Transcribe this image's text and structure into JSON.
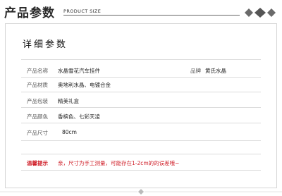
{
  "header": {
    "title": "产品参数",
    "subtitle": "PRODUCT SIZE"
  },
  "card": {
    "title": "详细参数"
  },
  "params": [
    {
      "label": "产品名称",
      "value": "水晶雪花汽车挂件",
      "extra_label": "品牌",
      "extra_value": "黄氏水晶"
    },
    {
      "label": "产品材质",
      "value": "奥地利水晶、电镀合金"
    },
    {
      "label": "产品包装",
      "value": "精美礼盒"
    },
    {
      "label": "产品颜色",
      "value": "香槟色、七彩天凌"
    },
    {
      "label": "产品尺寸",
      "value": "80cm"
    }
  ],
  "tip": {
    "label": "温馨提示",
    "text": "亲，尺寸为手工测量，可能存在1-2cm的的误差哦~"
  },
  "colors": {
    "tip": "#d0202a",
    "border": "#d6d6d6",
    "divider": "#dcdcdc"
  }
}
